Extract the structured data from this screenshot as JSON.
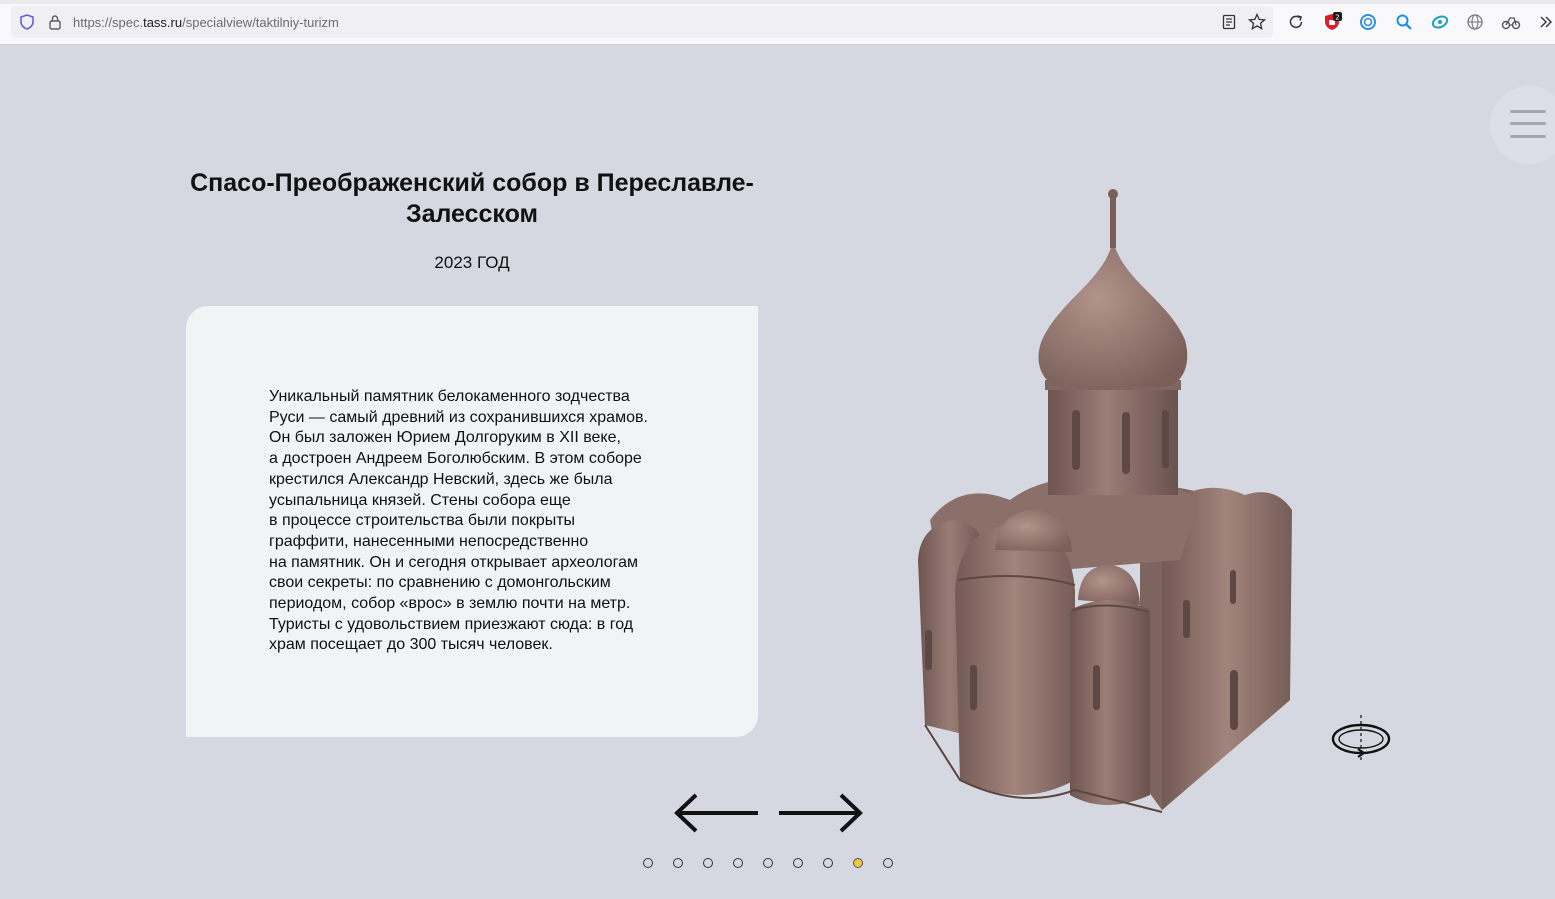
{
  "browser": {
    "url_prefix": "https://spec.",
    "url_host": "tass.ru",
    "url_path": "/specialview/taktilniy-turizm",
    "badge_count": "2"
  },
  "page": {
    "title": "Спасо-Преображенский собор в Переславле-Залесском",
    "year": "2023 ГОД",
    "description": "Уникальный памятник белокаменного зодчества\nРуси — самый древний из сохранившихся храмов.\nОн был заложен Юрием Долгоруким в XII веке,\nа достроен Андреем Боголюбским. В этом соборе\nкрестился Александр Невский, здесь же была\nусыпальница князей. Стены собора еще\nв процессе строительства были покрыты\nграффити, нанесенными непосредственно\nна памятник. Он и сегодня открывает археологам\nсвои секреты: по сравнению с домонгольским\nпериодом, собор «врос» в землю почти на метр.\nТуристы с удовольствием приезжают сюда: в год\nхрам посещает до 300 тысяч человек."
  },
  "pagination": {
    "total": 9,
    "active_index": 7
  },
  "colors": {
    "background": "#d5d8e1",
    "card": "#f2f3f5",
    "model": "#8a6d66",
    "active_dot": "#f0c93a"
  },
  "icons": [
    "shield-icon",
    "lock-icon",
    "reader-icon",
    "star-icon",
    "reload-icon",
    "extension-icon",
    "search-icon",
    "globe-icon",
    "overflow-icon",
    "menu-icon",
    "arrow-left-icon",
    "arrow-right-icon",
    "rotate-icon"
  ]
}
